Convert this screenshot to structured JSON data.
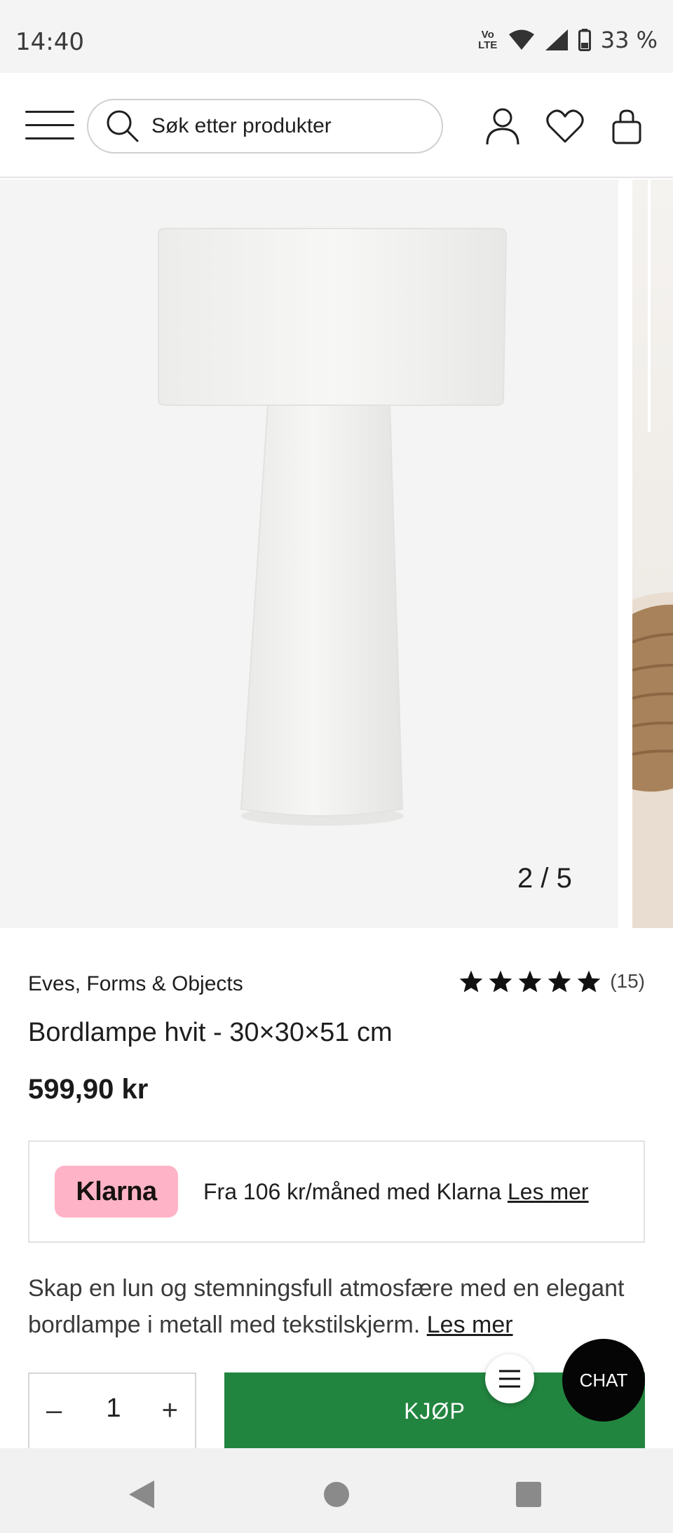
{
  "status_bar": {
    "time": "14:40",
    "volte_label": "Vo LTE",
    "battery": "33 %"
  },
  "header": {
    "search_placeholder": "Søk etter produkter"
  },
  "gallery": {
    "counter": "2 / 5"
  },
  "product": {
    "brand": "Eves, Forms & Objects",
    "rating_stars": 5,
    "rating_count": "(15)",
    "title": "Bordlampe hvit - 30×30×51 cm",
    "price": "599,90 kr"
  },
  "klarna": {
    "logo": "Klarna",
    "text": "Fra 106 kr/måned med Klarna",
    "link": "Les mer",
    "logo_color": "#ffb3c7"
  },
  "description": {
    "text": "Skap en lun og stemningsfull atmosfære med en elegant bordlampe i metall med tekstilskjerm.",
    "more": "Les mer"
  },
  "purchase": {
    "quantity": "1",
    "minus": "–",
    "plus": "+",
    "buy_label": "KJØP",
    "buy_color": "#22853f"
  },
  "chat": {
    "label": "CHAT"
  }
}
